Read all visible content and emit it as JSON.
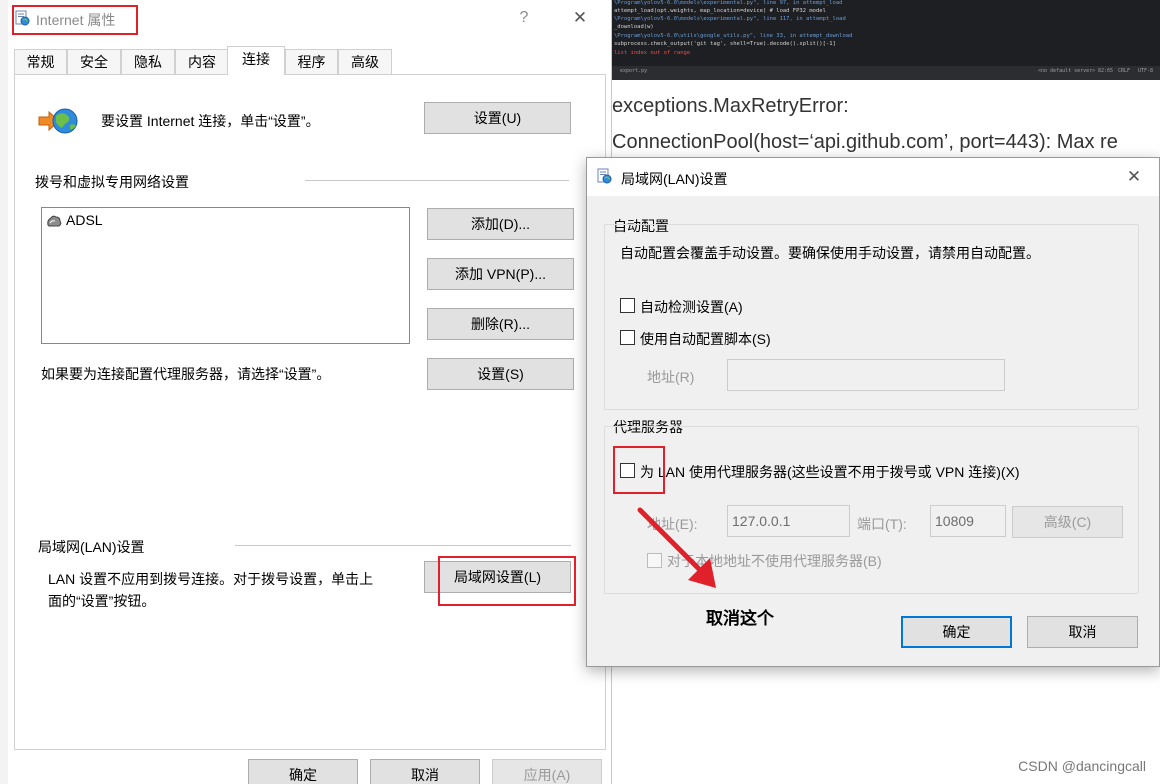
{
  "background": {
    "code_lines": [
      "\\Program\\yolov5-6.0\\models\\experimental.py\", line 97, in attempt_load",
      "    attempt_load(opt.weights, map_location=device)  # load FP32 model",
      "\\Program\\yolov5-6.0\\models\\experimental.py\", line 117, in attempt_load",
      "    _download(w)",
      "\\Program\\yolov5-6.0\\utils\\google_utils.py\", line 33, in attempt_download",
      "    subprocess.check_output('git tag', shell=True).decode().split()[-1]",
      "    list index out of range"
    ],
    "editor_tab": "export.py",
    "status_items": [
      "<no default server>",
      "82:65",
      "CRLF",
      "UTF-8"
    ],
    "article_lines": [
      "exceptions.MaxRetryError:",
      "ConnectionPool(host=‘api.github.com’, port=443): Max re"
    ],
    "watermark": "CSDN @dancingcall"
  },
  "inet_dialog": {
    "title": "Internet 属性",
    "help_label": "?",
    "close_label": "✕",
    "tabs": [
      "常规",
      "安全",
      "隐私",
      "内容",
      "连接",
      "程序",
      "高级"
    ],
    "active_tab_index": 4,
    "setup": {
      "text": "要设置 Internet 连接，单击“设置”。",
      "button": "设置(U)"
    },
    "dialup": {
      "header": "拨号和虚拟专用网络设置",
      "items": [
        "ADSL"
      ],
      "add_button": "添加(D)...",
      "add_vpn_button": "添加 VPN(P)...",
      "remove_button": "删除(R)...",
      "proxy_text": "如果要为连接配置代理服务器，请选择“设置”。",
      "settings_button": "设置(S)"
    },
    "lan": {
      "header": "局域网(LAN)设置",
      "text_line1": "LAN 设置不应用到拨号连接。对于拨号设置，单击上",
      "text_line2": "面的“设置”按钮。",
      "button": "局域网设置(L)"
    },
    "footer": {
      "ok": "确定",
      "cancel": "取消",
      "apply": "应用(A)"
    }
  },
  "lan_dialog": {
    "title": "局域网(LAN)设置",
    "close_label": "✕",
    "auto_config": {
      "legend": "自动配置",
      "description": "自动配置会覆盖手动设置。要确保使用手动设置，请禁用自动配置。",
      "auto_detect_label": "自动检测设置(A)",
      "auto_detect_checked": false,
      "use_script_label": "使用自动配置脚本(S)",
      "use_script_checked": false,
      "address_label": "地址(R)",
      "address_value": ""
    },
    "proxy": {
      "legend": "代理服务器",
      "use_proxy_label": "为 LAN 使用代理服务器(这些设置不用于拨号或 VPN 连接)(X)",
      "use_proxy_checked": false,
      "address_label": "地址(E):",
      "address_value": "127.0.0.1",
      "port_label": "端口(T):",
      "port_value": "10809",
      "advanced_button": "高级(C)",
      "bypass_label": "对于本地地址不使用代理服务器(B)",
      "bypass_checked": false
    },
    "ok": "确定",
    "cancel": "取消"
  },
  "annotation": {
    "text": "取消这个",
    "color": "#e0202a"
  }
}
